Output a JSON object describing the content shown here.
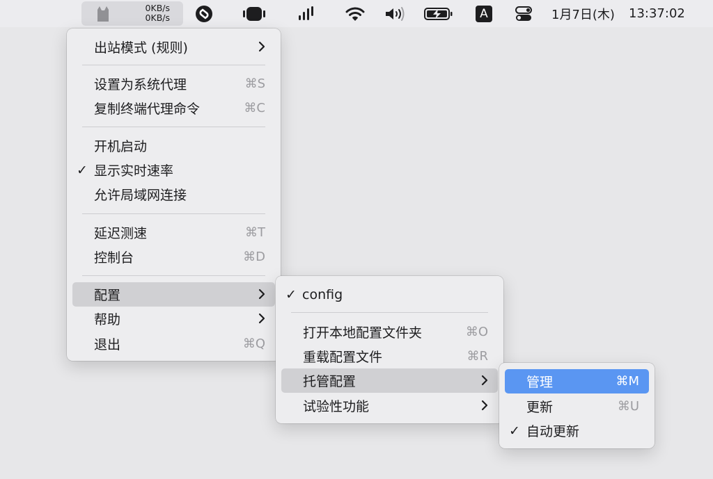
{
  "menubar": {
    "speed_up": "0KB/s",
    "speed_down": "0KB/s",
    "icons": [
      "clash-cat-icon",
      "shazam-icon",
      "screen-mirror-icon",
      "audio-bars-icon",
      "wifi-icon",
      "volume-icon",
      "battery-charging-icon",
      "input-source-icon",
      "control-center-icon"
    ],
    "input_source": "A",
    "date": "1月7日(木)",
    "time": "13:37:02"
  },
  "main_menu": {
    "outbound": "出站模式 (规则)",
    "set_proxy": "设置为系统代理",
    "set_proxy_sc": "⌘S",
    "copy_cmd": "复制终端代理命令",
    "copy_cmd_sc": "⌘C",
    "launch": "开机启动",
    "show_speed": "显示实时速率",
    "lan": "允许局域网连接",
    "latency": "延迟测速",
    "latency_sc": "⌘T",
    "console": "控制台",
    "console_sc": "⌘D",
    "config": "配置",
    "help": "帮助",
    "quit": "退出",
    "quit_sc": "⌘Q",
    "check": "✓"
  },
  "config_menu": {
    "config_name": "config",
    "open_folder": "打开本地配置文件夹",
    "open_folder_sc": "⌘O",
    "reload": "重载配置文件",
    "reload_sc": "⌘R",
    "hosted": "托管配置",
    "experimental": "试验性功能",
    "check": "✓"
  },
  "hosted_menu": {
    "manage": "管理",
    "manage_sc": "⌘M",
    "update": "更新",
    "update_sc": "⌘U",
    "auto_update": "自动更新",
    "check": "✓"
  },
  "colors": {
    "highlight": "#5a96f2",
    "menu_bg": "#ededef",
    "hover": "#d0d0d3"
  }
}
